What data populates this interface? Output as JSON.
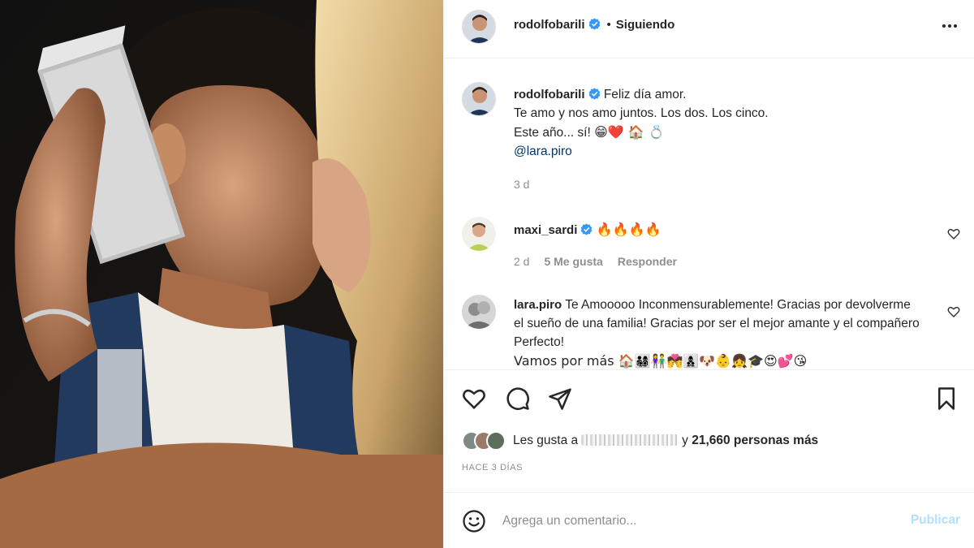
{
  "post": {
    "author": "rodolfobarili",
    "follow_status": "Siguiendo",
    "separator": "•"
  },
  "caption": {
    "username": "rodolfobarili",
    "line1": "Feliz día amor.",
    "line2": "Te amo y nos amo juntos. Los dos. Los cinco.",
    "line3_text": "Este año... sí!",
    "line3_emojis": "😁❤️ 🏠 💍",
    "mention": "@lara.piro",
    "age": "3 d"
  },
  "comments": [
    {
      "username": "maxi_sardi",
      "text": "🔥🔥🔥🔥",
      "age": "2 d",
      "likes": "5 Me gusta",
      "reply": "Responder"
    },
    {
      "username": "lara.piro",
      "text": "Te Amooooo Inconmensurablemente! Gracias por devolverme el sueño de una familia! Gracias por ser el mejor amante y el compañero Perfecto!",
      "text_cont": "Vamos por más 🏠👨‍👩‍👧‍👦👫💏👩‍👦‍👦🐶👶👧🎓😍💕😘"
    }
  ],
  "likes": {
    "prefix": "Les gusta a",
    "suffix_and": "y",
    "count_text": "21,660 personas más"
  },
  "timestamp": "HACE 3 DÍAS",
  "comment_box": {
    "placeholder": "Agrega un comentario...",
    "publish_label": "Publicar"
  },
  "colors": {
    "verified": "#3897f0",
    "publish_disabled": "#b2dffc",
    "secondary_text": "#8e8e8e",
    "mention": "#00376b"
  },
  "icons": [
    "verified-badge-icon",
    "more-options-icon",
    "heart-icon",
    "comment-icon",
    "share-icon",
    "save-icon",
    "emoji-icon"
  ]
}
